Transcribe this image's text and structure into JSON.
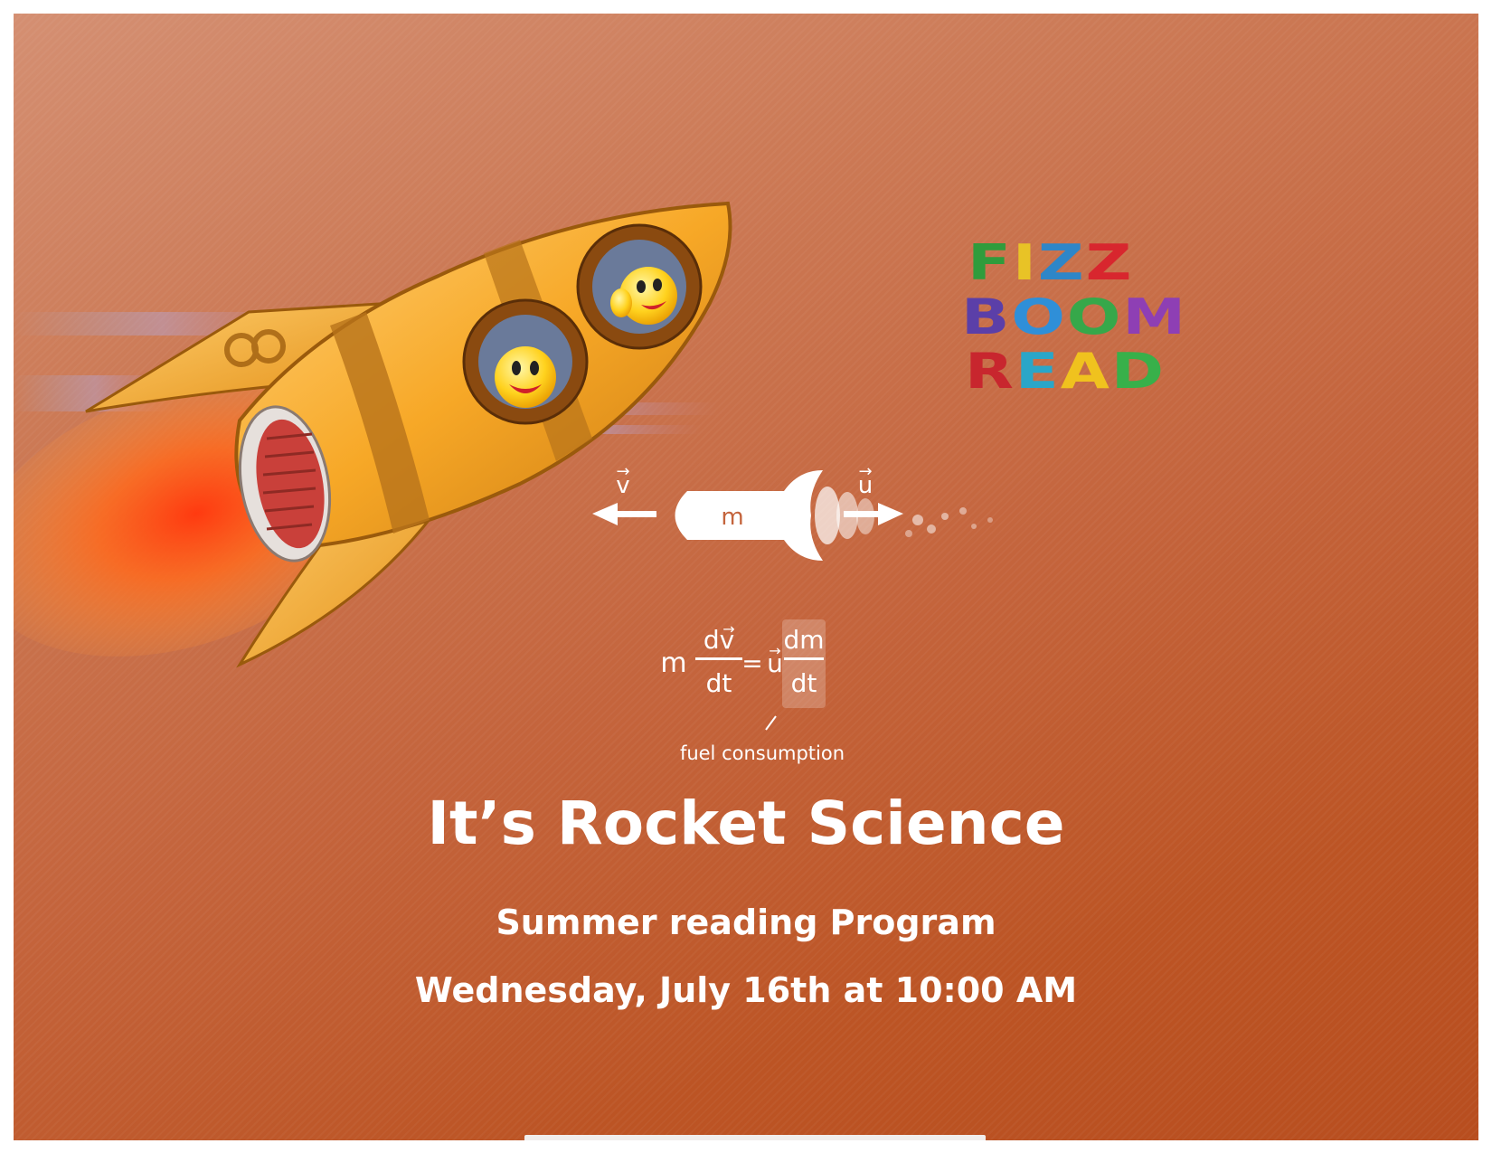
{
  "logo": {
    "line1": [
      "F",
      "I",
      "Z",
      "Z"
    ],
    "line2": [
      "B",
      "O",
      "O",
      "M"
    ],
    "line3": [
      "R",
      "E",
      "A",
      "D"
    ],
    "colors": {
      "line1": [
        "#2f9c3c",
        "#e8c326",
        "#2e86c8",
        "#d8262e"
      ],
      "line2": [
        "#5b3fa8",
        "#2f8fd8",
        "#36a84a",
        "#8e3fb4"
      ],
      "line3": [
        "#c8262e",
        "#2aa6c8",
        "#f0c21e",
        "#38b04a"
      ]
    }
  },
  "diagram": {
    "velocity_label": "v",
    "exhaust_label": "u",
    "mass_label": "m",
    "equation": {
      "lhs_m": "m",
      "num1": "dv",
      "den1": "dt",
      "equals": "=",
      "u": "u",
      "num2": "dm",
      "den2": "dt"
    },
    "fuel_caption": "fuel consumption"
  },
  "event": {
    "title": "It’s Rocket Science",
    "subtitle": "Summer reading Program",
    "datetime": "Wednesday, July 16th at 10:00 AM"
  },
  "colors": {
    "background": "#c4643c",
    "rocket_body": "#f6a623",
    "rocket_stripe": "#b8731a",
    "flame": "#ff4a1a",
    "text": "#ffffff"
  }
}
